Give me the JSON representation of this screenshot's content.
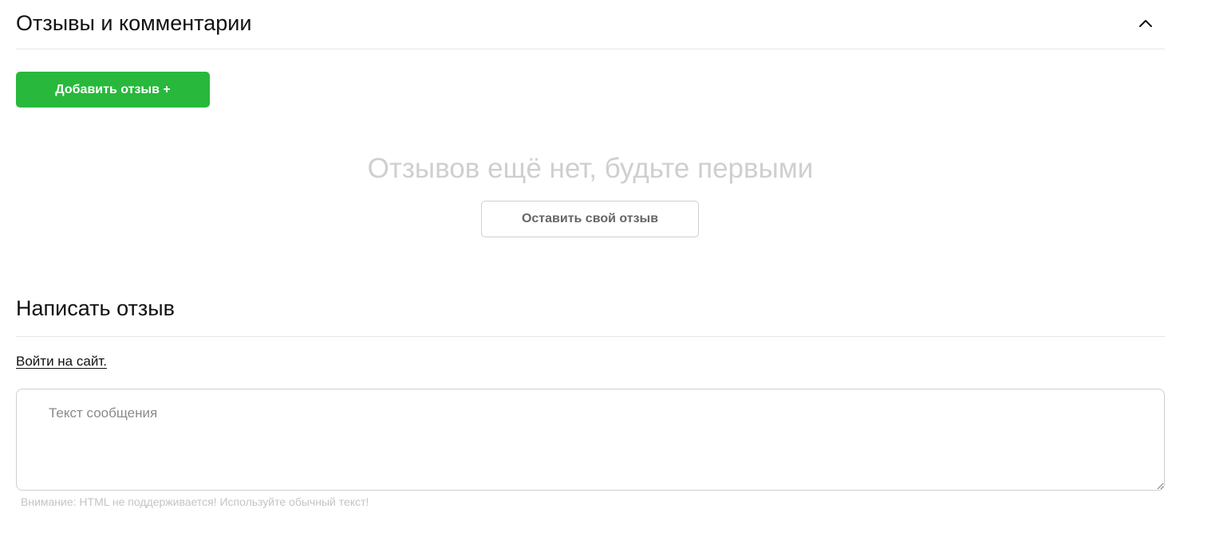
{
  "reviews": {
    "title": "Отзывы и комментарии",
    "collapse_icon": "chevron-up-icon",
    "add_review_label": "Добавить отзыв +",
    "empty_message": "Отзывов ещё нет, будьте первыми",
    "leave_review_label": "Оставить свой отзыв"
  },
  "write": {
    "title": "Написать отзыв",
    "login_link": "Войти на сайт.",
    "message_value": "",
    "message_placeholder": "Текст сообщения",
    "note": "Внимание: HTML не поддерживается! Используйте обычный текст!"
  },
  "colors": {
    "accent_green": "#28b83c",
    "muted_text": "#cfcfcf",
    "divider": "#e6e6e6"
  }
}
